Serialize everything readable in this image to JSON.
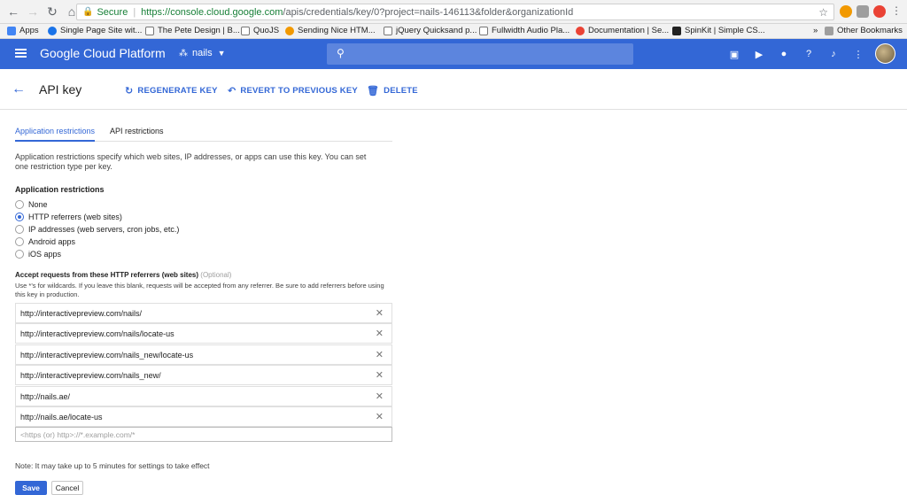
{
  "browser": {
    "secure_label": "Secure",
    "url_host": "https://console.cloud.google.com",
    "url_rest": "/apis/credentials/key/0?project=nails-146113&folder&organizationId",
    "bookmarks": [
      {
        "label": "Apps",
        "color": "#4285f4"
      },
      {
        "label": "Single Page Site wit...",
        "color": "#1a73e8"
      },
      {
        "label": "The Pete Design | B...",
        "color": "#777777"
      },
      {
        "label": "QuoJS",
        "color": "#777777"
      },
      {
        "label": "Sending Nice HTM...",
        "color": "#f29900"
      },
      {
        "label": "jQuery Quicksand p...",
        "color": "#777777"
      },
      {
        "label": "Fullwidth Audio Pla...",
        "color": "#777777"
      },
      {
        "label": "Documentation | Se...",
        "color": "#ea4335"
      },
      {
        "label": "SpinKit | Simple CS...",
        "color": "#222222"
      }
    ],
    "more_label": "»",
    "other_bookmarks": "Other Bookmarks"
  },
  "header": {
    "brand": "Google Cloud Platform",
    "project": "nails",
    "brand_color": "#3367d6"
  },
  "action_bar": {
    "title": "API key",
    "regenerate": "REGENERATE KEY",
    "revert": "REVERT TO PREVIOUS KEY",
    "delete": "DELETE"
  },
  "tabs": {
    "application": "Application restrictions",
    "api": "API restrictions"
  },
  "content": {
    "description": "Application restrictions specify which web sites, IP addresses, or apps can use this key. You can set one restriction type per key.",
    "section_label": "Application restrictions",
    "options": [
      {
        "label": "None",
        "checked": false
      },
      {
        "label": "HTTP referrers (web sites)",
        "checked": true
      },
      {
        "label": "IP addresses (web servers, cron jobs, etc.)",
        "checked": false
      },
      {
        "label": "Android apps",
        "checked": false
      },
      {
        "label": "iOS apps",
        "checked": false
      }
    ],
    "accept_label": "Accept requests from these HTTP referrers (web sites)",
    "optional": "(Optional)",
    "hint": "Use *'s for wildcards. If you leave this blank, requests will be accepted from any referrer. Be sure to add referrers before using this key in production.",
    "referrers": [
      "http://interactivepreview.com/nails/",
      "http://interactivepreview.com/nails/locate-us",
      "http://interactivepreview.com/nails_new/locate-us",
      "http://interactivepreview.com/nails_new/",
      "http://nails.ae/",
      "http://nails.ae/locate-us"
    ],
    "input_placeholder": "<https (or) http>://*.example.com/*",
    "note": "Note: It may take up to 5 minutes for settings to take effect",
    "save": "Save",
    "cancel": "Cancel"
  }
}
